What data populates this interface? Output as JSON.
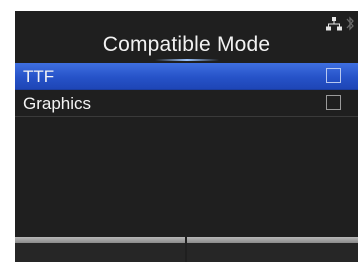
{
  "header": {
    "title": "Compatible Mode",
    "status_icons": [
      "network-icon",
      "bluetooth-icon"
    ]
  },
  "list": {
    "items": [
      {
        "label": "TTF",
        "selected": true,
        "checked": false
      },
      {
        "label": "Graphics",
        "selected": false,
        "checked": false
      }
    ]
  },
  "softkeys": {
    "left_label": "",
    "right_label": ""
  },
  "colors": {
    "background": "#1f1f1f",
    "selection": "#2652c8",
    "text": "#f4f4f4",
    "softkey_bar": "#a0a0a0"
  }
}
